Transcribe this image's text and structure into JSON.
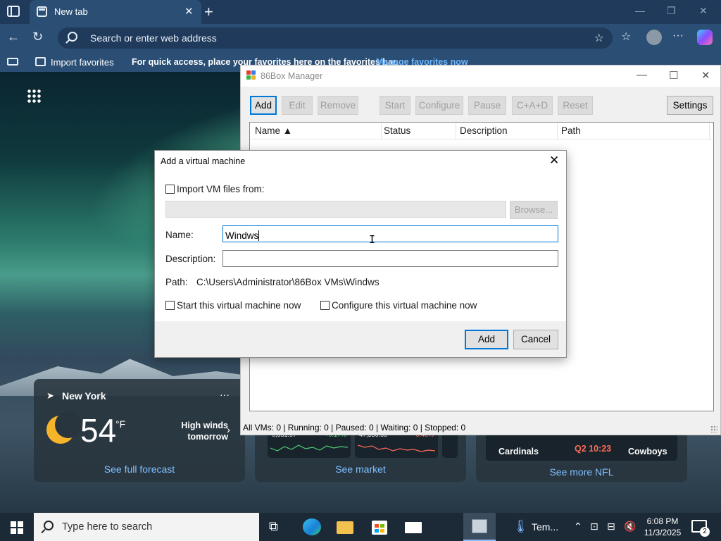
{
  "browser": {
    "tab_title": "New tab",
    "tab_close": "✕",
    "new_tab": "+",
    "address_placeholder": "Search or enter web address",
    "import_favorites": "Import favorites",
    "favbar_message": "For quick access, place your favorites here on the favorites bar.",
    "favbar_link": "Manage favorites now"
  },
  "weather": {
    "location": "New York",
    "more": "···",
    "temperature": "54",
    "unit": "°F",
    "alert": "High winds tomorrow",
    "link": "See full forecast"
  },
  "market": {
    "tiles": [
      {
        "value": "6,851.97",
        "change": "+0.17%"
      },
      {
        "value": "47,336.68",
        "change": "-0.48%"
      }
    ],
    "link": "See market"
  },
  "nfl": {
    "team_a": "Cardinals",
    "score": "Q2 10:23",
    "team_b": "Cowboys",
    "link": "See more NFL"
  },
  "manager": {
    "title": "86Box Manager",
    "toolbar": {
      "add": "Add",
      "edit": "Edit",
      "remove": "Remove",
      "start": "Start",
      "configure": "Configure",
      "pause": "Pause",
      "cad": "C+A+D",
      "reset": "Reset",
      "settings": "Settings"
    },
    "columns": {
      "name": "Name ▲",
      "status": "Status",
      "description": "Description",
      "path": "Path"
    },
    "status_bar": "All VMs: 0 | Running: 0 | Paused: 0 | Waiting: 0 | Stopped: 0"
  },
  "dialog": {
    "title": "Add a virtual machine",
    "import_label": "Import VM files from:",
    "import_checked": false,
    "import_path_value": "",
    "browse": "Browse...",
    "name_label": "Name:",
    "name_value": "Windws",
    "description_label": "Description:",
    "description_value": "",
    "path_label": "Path:",
    "path_value": "C:\\Users\\Administrator\\86Box VMs\\Windws",
    "start_now_label": "Start this virtual machine now",
    "start_now_checked": false,
    "configure_now_label": "Configure this virtual machine now",
    "configure_now_checked": false,
    "add_button": "Add",
    "cancel_button": "Cancel"
  },
  "taskbar": {
    "search_placeholder": "Type here to search",
    "weather_text": "Tem...",
    "time": "6:08 PM",
    "date": "11/3/2025",
    "notification_count": "2"
  },
  "colors": {
    "accent": "#0078d7",
    "browser_chrome": "#2b4e74",
    "taskbar": "#1c2a38"
  }
}
